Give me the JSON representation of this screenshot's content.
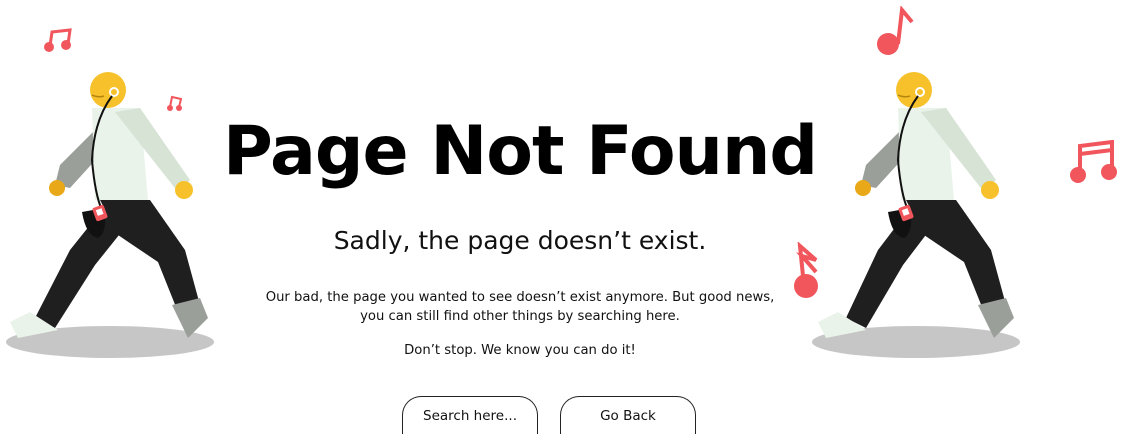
{
  "page": {
    "title": "Page Not Found",
    "subtitle": "Sadly, the page doesn’t exist.",
    "body_line1": "Our bad, the page you wanted to see doesn’t exist anymore. But good news,",
    "body_line2": "you can still find other things by searching here.",
    "encouragement": "Don’t stop. We know you can do it!"
  },
  "buttons": {
    "search_label": "Search here...",
    "back_label": "Go Back"
  },
  "colors": {
    "accent_note": "#f0565b",
    "head": "#f6c12a",
    "shirt": "#e9f3ea",
    "pants": "#1f1f1f",
    "shadow": "#c6c6c6"
  },
  "icons": [
    "music-note-icon",
    "walking-person-illustration"
  ]
}
